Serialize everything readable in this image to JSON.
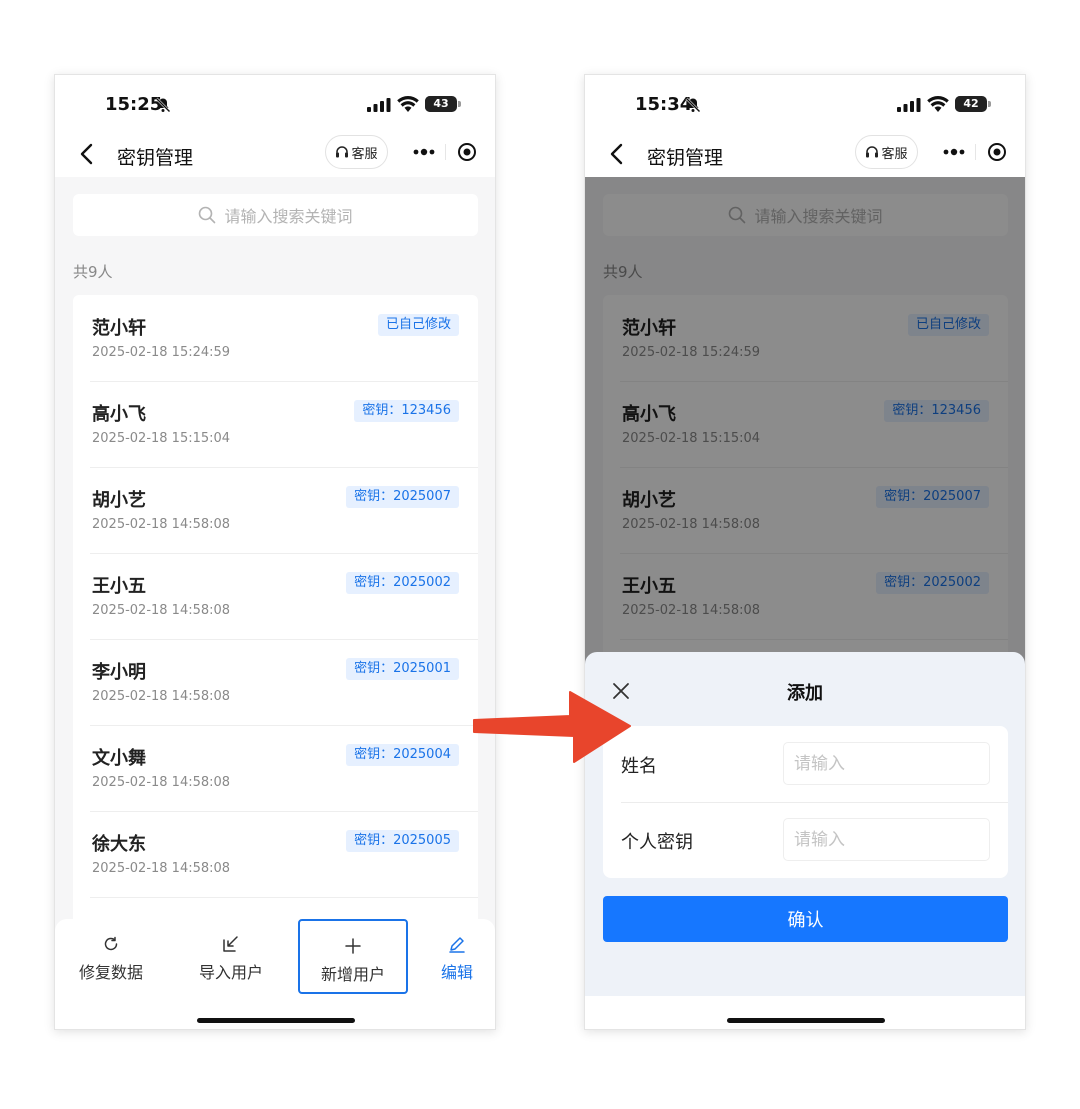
{
  "left_screen": {
    "status": {
      "time": "15:25",
      "battery": "43",
      "battery_level": 43
    },
    "nav": {
      "title": "密钥管理",
      "cs_label": "客服"
    },
    "search": {
      "placeholder": "请输入搜索关键词"
    },
    "count_label": "共9人",
    "list": [
      {
        "name": "范小轩",
        "time": "2025-02-18 15:24:59",
        "badge": "已自己修改"
      },
      {
        "name": "高小飞",
        "time": "2025-02-18 15:15:04",
        "badge": "密钥：123456"
      },
      {
        "name": "胡小艺",
        "time": "2025-02-18 14:58:08",
        "badge": "密钥：2025007"
      },
      {
        "name": "王小五",
        "time": "2025-02-18 14:58:08",
        "badge": "密钥：2025002"
      },
      {
        "name": "李小明",
        "time": "2025-02-18 14:58:08",
        "badge": "密钥：2025001"
      },
      {
        "name": "文小舞",
        "time": "2025-02-18 14:58:08",
        "badge": "密钥：2025004"
      },
      {
        "name": "徐大东",
        "time": "2025-02-18 14:58:08",
        "badge": "密钥：2025005"
      }
    ],
    "tabbar": {
      "repair": "修复数据",
      "import": "导入用户",
      "add": "新增用户",
      "edit": "编辑"
    }
  },
  "right_screen": {
    "status": {
      "time": "15:34",
      "battery": "42",
      "battery_level": 42
    },
    "nav": {
      "title": "密钥管理",
      "cs_label": "客服"
    },
    "search": {
      "placeholder": "请输入搜索关键词"
    },
    "count_label": "共9人",
    "list": [
      {
        "name": "范小轩",
        "time": "2025-02-18 15:24:59",
        "badge": "已自己修改"
      },
      {
        "name": "高小飞",
        "time": "2025-02-18 15:15:04",
        "badge": "密钥：123456"
      },
      {
        "name": "胡小艺",
        "time": "2025-02-18 14:58:08",
        "badge": "密钥：2025007"
      },
      {
        "name": "王小五",
        "time": "2025-02-18 14:58:08",
        "badge": "密钥：2025002"
      }
    ],
    "sheet": {
      "title": "添加",
      "name_label": "姓名",
      "name_placeholder": "请输入",
      "key_label": "个人密钥",
      "key_placeholder": "请输入",
      "confirm": "确认"
    }
  },
  "colors": {
    "accent": "#1677ff",
    "badge_bg": "#e6f0ff",
    "arrow": "#e8452c"
  }
}
